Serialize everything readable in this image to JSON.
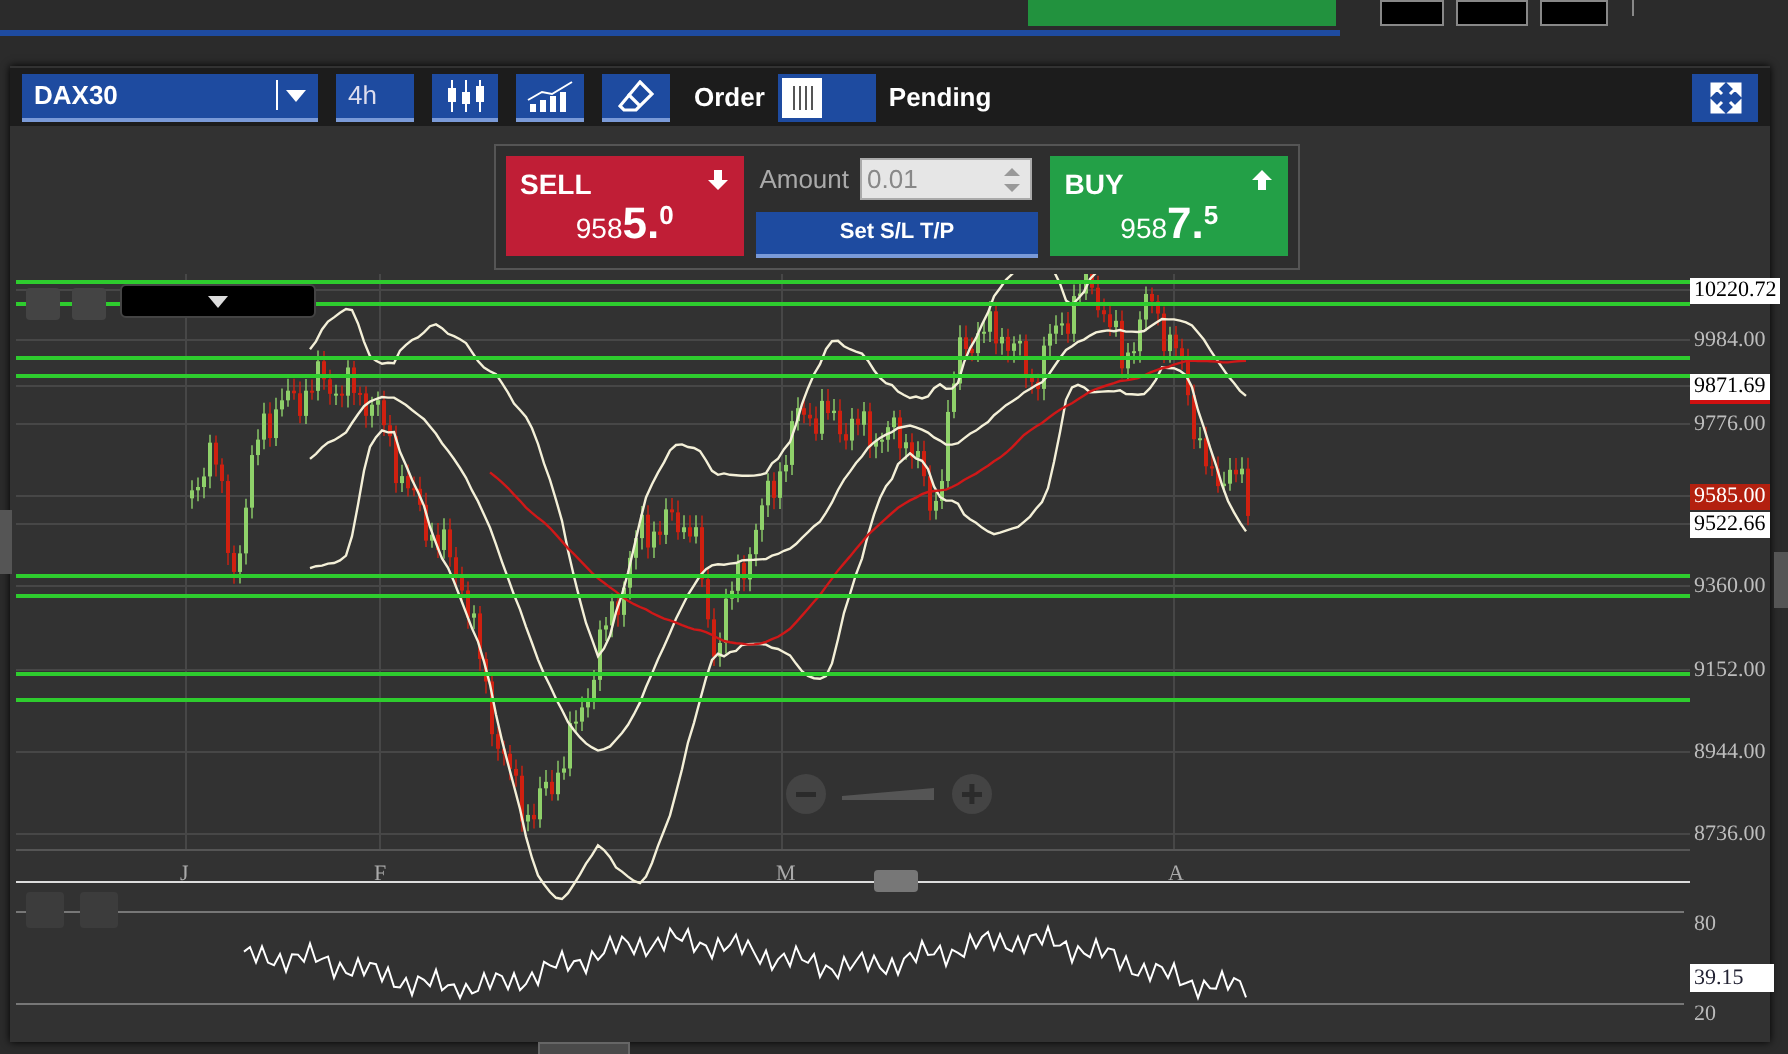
{
  "toolbar": {
    "symbol": "DAX30",
    "timeframe": "4h",
    "order_label": "Order",
    "order_toggle": {
      "on": false
    },
    "pending_label": "Pending"
  },
  "trade": {
    "sell": {
      "label": "SELL",
      "price_main": "958",
      "price_big": "5.",
      "price_sup": "0"
    },
    "amount": {
      "label": "Amount",
      "value": "0.01"
    },
    "sl_tp_button": "Set S/L T/P",
    "buy": {
      "label": "BUY",
      "price_main": "958",
      "price_big": "7.",
      "price_sup": "5"
    }
  },
  "price_axis": [
    {
      "label": "10220.72",
      "kind": "boxed"
    },
    {
      "label": "9984.00",
      "kind": "plain"
    },
    {
      "label": "9871.69",
      "kind": "marked"
    },
    {
      "label": "9776.00",
      "kind": "plain"
    },
    {
      "label": "9585.00",
      "kind": "alert"
    },
    {
      "label": "9522.66",
      "kind": "boxed"
    },
    {
      "label": "9360.00",
      "kind": "plain"
    },
    {
      "label": "9152.00",
      "kind": "plain"
    },
    {
      "label": "8944.00",
      "kind": "plain"
    },
    {
      "label": "8736.00",
      "kind": "plain"
    }
  ],
  "time_axis": [
    "J",
    "F",
    "M",
    "A"
  ],
  "oscillator_axis": [
    {
      "label": "80",
      "kind": "plain"
    },
    {
      "label": "39.15",
      "kind": "boxed"
    },
    {
      "label": "20",
      "kind": "plain"
    }
  ]
}
